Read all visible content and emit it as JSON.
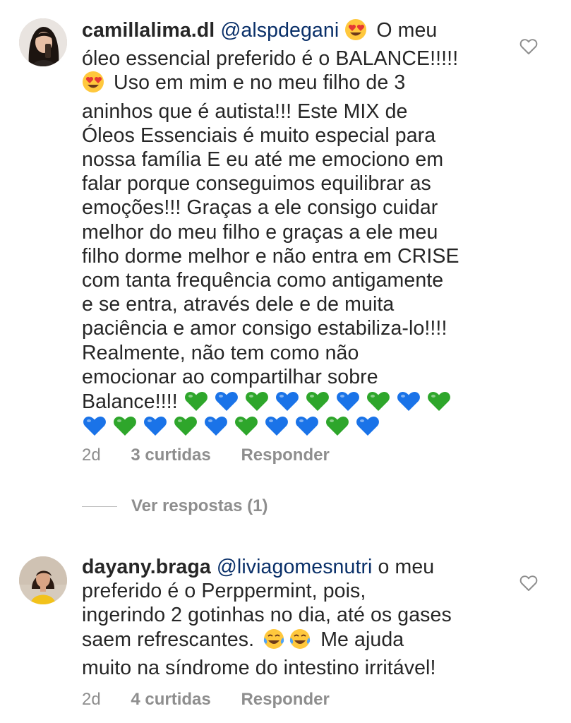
{
  "comments": [
    {
      "username": "camillalima.dl",
      "mention": "@alspdegani",
      "lines": [
        "O meu",
        "óleo essencial preferido é o BALANCE!!!!!",
        "Uso em mim e no meu filho de 3",
        "aninhos que é autista!!! Este MIX de",
        "Óleos Essenciais é muito especial para",
        "nossa família E eu até me emociono em",
        "falar porque conseguimos equilibrar as",
        "emoções!!! Graças a ele consigo cuidar",
        "melhor do meu filho e graças a ele meu",
        "filho dorme melhor e não entra em CRISE",
        "com tanta frequência como antigamente",
        "e se entra, através dele e de muita",
        "paciência e amor consigo estabiliza-lo!!!!",
        "Realmente, não tem como não",
        "emocionar ao compartilhar sobre",
        "Balance!!!!"
      ],
      "emojis": [
        "heart-eyes-emoji",
        "heart-eyes-emoji"
      ],
      "hearts_line1": [
        "green",
        "blue",
        "green",
        "blue",
        "green",
        "blue",
        "green",
        "blue",
        "green"
      ],
      "hearts_line2": [
        "blue",
        "green",
        "blue",
        "green",
        "blue",
        "green",
        "blue",
        "blue",
        "green",
        "blue"
      ],
      "time": "2d",
      "likes": "3 curtidas",
      "reply": "Responder",
      "like_icon": "heart-outline-icon"
    },
    {
      "username": "dayany.braga",
      "mention": "@liviagomesnutri",
      "lines": [
        "o meu",
        "preferido é o Perppermint, pois,",
        "ingerindo 2 gotinhas no dia, até os gases",
        "saem refrescantes.",
        "Me ajuda",
        "muito na síndrome do intestino irritável!"
      ],
      "emojis": [
        "tears-of-joy-emoji",
        "tears-of-joy-emoji"
      ],
      "time": "2d",
      "likes": "4 curtidas",
      "reply": "Responder",
      "like_icon": "heart-outline-icon"
    }
  ],
  "view_replies": "Ver respostas (1)",
  "colors": {
    "text": "#262626",
    "meta": "#8e8e8e",
    "mention": "#0a3069",
    "green_heart": "#2ea62b",
    "blue_heart": "#1a73e8",
    "emoji_yellow": "#ffc83d"
  }
}
